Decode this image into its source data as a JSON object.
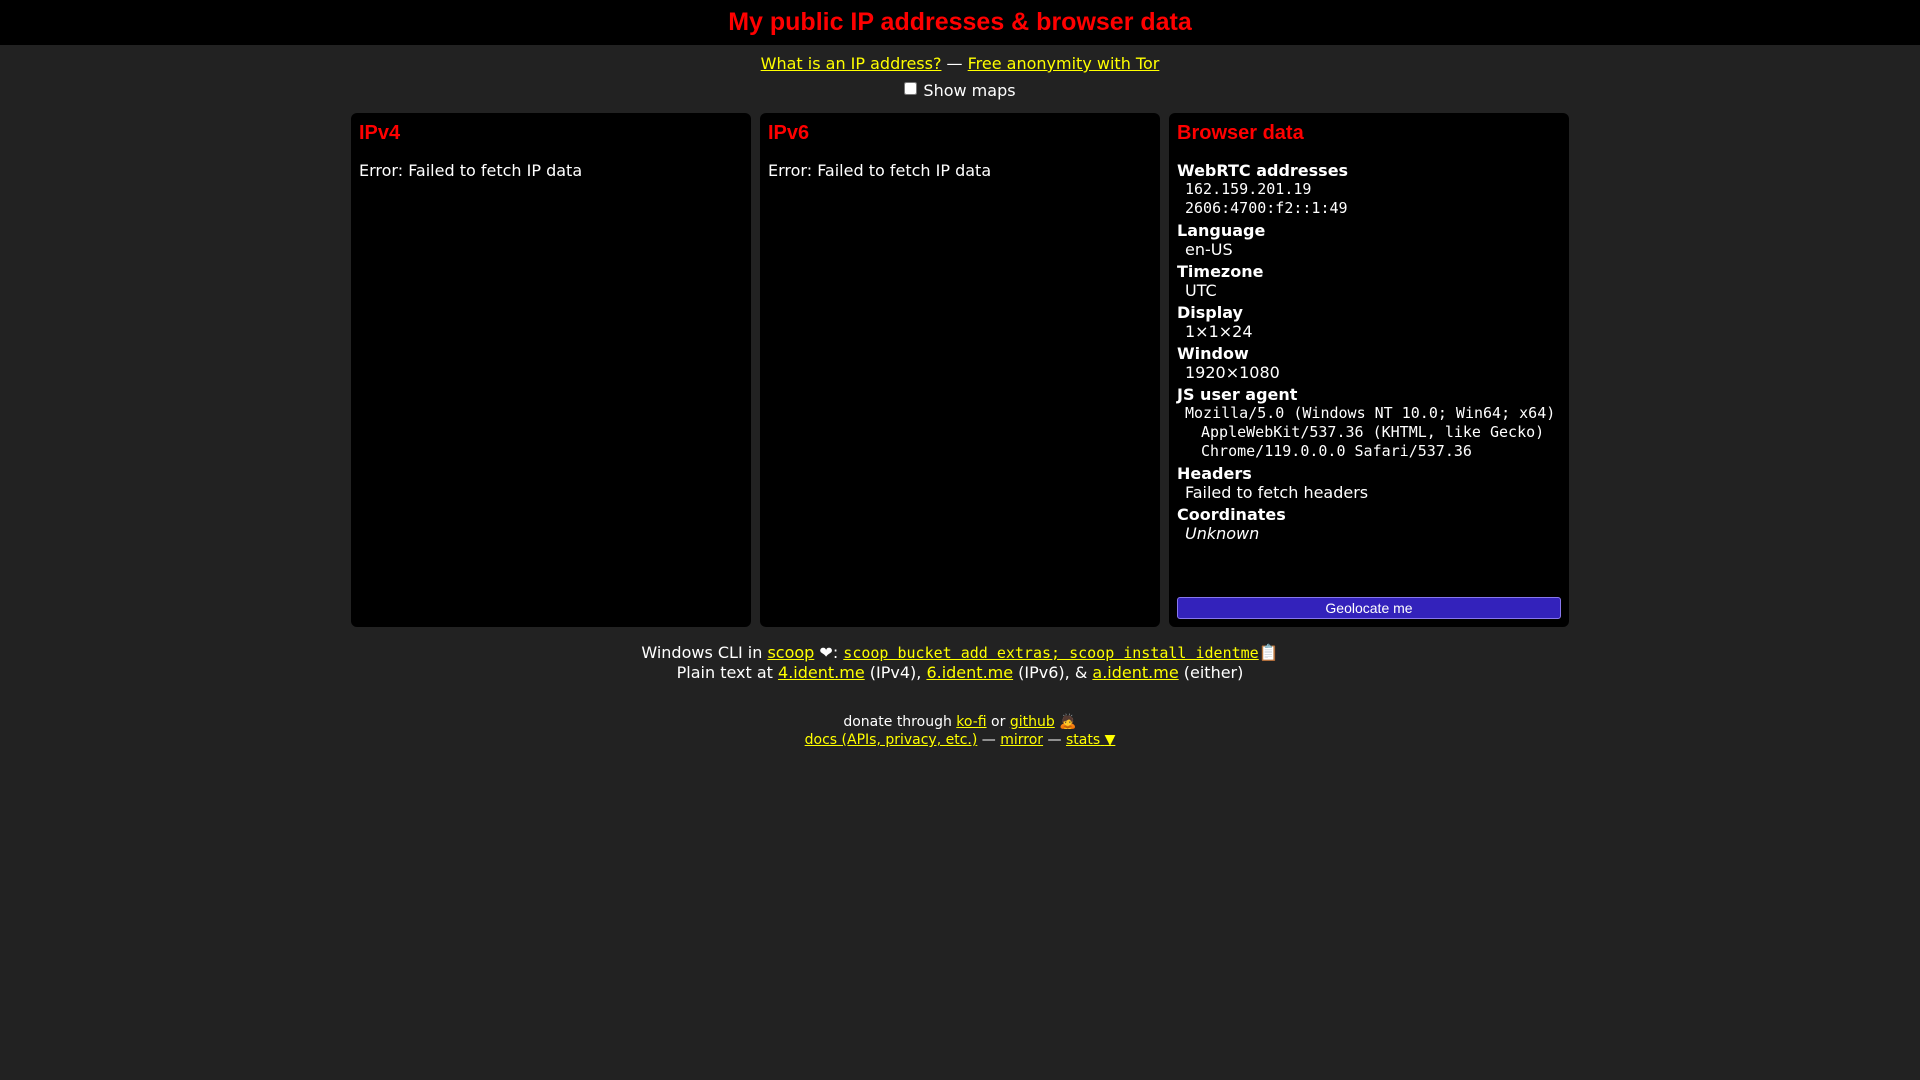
{
  "header": {
    "title": "My public IP addresses & browser data"
  },
  "links": {
    "what_is_ip": "What is an IP address?",
    "sep": " — ",
    "tor": "Free anonymity with Tor"
  },
  "maps": {
    "label": "Show maps"
  },
  "ipv4": {
    "title": "IPv4",
    "error": "Error: Failed to fetch IP data"
  },
  "ipv6": {
    "title": "IPv6",
    "error": "Error: Failed to fetch IP data"
  },
  "browser": {
    "title": "Browser data",
    "webrtc_label": "WebRTC addresses",
    "webrtc_values": [
      "162.159.201.19",
      "2606:4700:f2::1:49"
    ],
    "language_label": "Language",
    "language_value": "en-US",
    "timezone_label": "Timezone",
    "timezone_value": "UTC",
    "display_label": "Display",
    "display_value": "1×1×24",
    "window_label": "Window",
    "window_value": "1920×1080",
    "ua_label": "JS user agent",
    "ua_value": "Mozilla/5.0 (Windows NT 10.0; Win64; x64) AppleWebKit/537.36 (KHTML, like Gecko) Chrome/119.0.0.0 Safari/537.36",
    "headers_label": "Headers",
    "headers_value": "Failed to fetch headers",
    "coords_label": "Coordinates",
    "coords_value": "Unknown",
    "geolocate_button": "Geolocate me"
  },
  "cli": {
    "prefix": "Windows CLI in ",
    "scoop_link": "scoop",
    "heart": "❤",
    "colon": ": ",
    "command": "scoop bucket add extras; scoop install identme",
    "clipboard": "📋"
  },
  "plain": {
    "prefix": "Plain text at ",
    "link4": "4.ident.me",
    "text4": " (IPv4), ",
    "link6": "6.ident.me",
    "text6": " (IPv6), & ",
    "linka": "a.ident.me",
    "texta": " (either)"
  },
  "footer": {
    "donate_prefix": "donate through ",
    "kofi": "ko-fi",
    "or": " or ",
    "github": "github",
    "emoji": "🙇",
    "docs": "docs (APIs, privacy, etc.)",
    "sep1": " — ",
    "mirror": "mirror",
    "sep2": " — ",
    "stats": "stats",
    "stats_arrow": "▼"
  }
}
